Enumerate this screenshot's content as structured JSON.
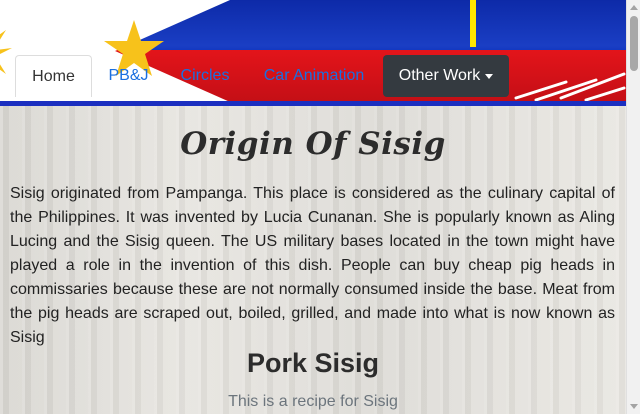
{
  "nav": {
    "items": [
      {
        "label": "Home"
      },
      {
        "label": "PB&J"
      },
      {
        "label": "Circles"
      },
      {
        "label": "Car Animation"
      }
    ],
    "dropdown_label": "Other Work"
  },
  "main": {
    "title": "Origin Of Sisig",
    "paragraph": "Sisig originated from Pampanga. This place is considered as the culinary capital of the Philippines. It was invented by Lucia Cunanan. She is popularly known as Aling Lucing and the Sisig queen. The US military bases located in the town might have played a role in the invention of this dish. People can buy cheap pig heads in commissaries because these are not normally consumed inside the base. Meat from the pig heads are scraped out, boiled, grilled, and made into what is now known as Sisig",
    "subtitle": "Pork Sisig",
    "recipe_caption": "This is a recipe for Sisig"
  },
  "colors": {
    "flag_blue": "#1237c0",
    "flag_red": "#c40f16",
    "flag_yellow": "#ffe600",
    "link": "#1a6fe0",
    "dropdown_bg": "#343a40"
  }
}
